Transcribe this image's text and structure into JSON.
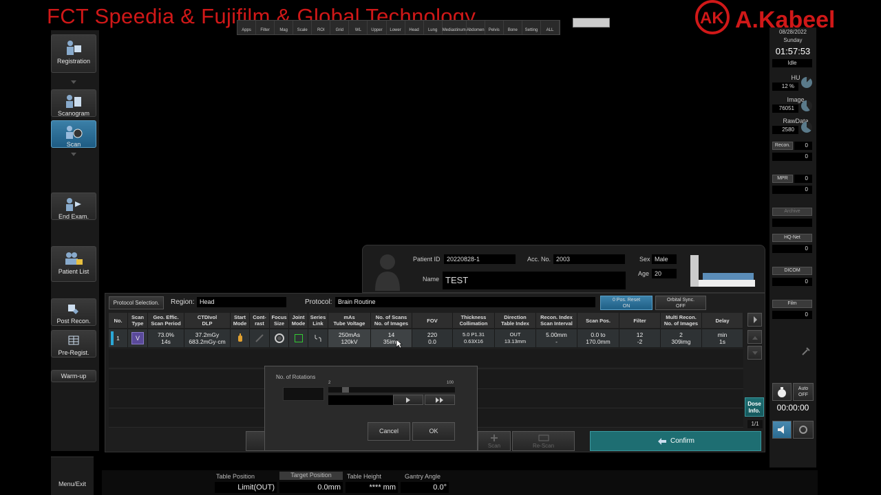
{
  "watermark": {
    "left": "FCT Speedia & Fujifilm & Global Technology",
    "right": "A.Kabeel"
  },
  "toolbar": {
    "items": [
      "Apps",
      "Filter",
      "Mag",
      "Scale",
      "ROI",
      "Grid",
      "WL",
      "Upper",
      "Lower",
      "Head",
      "Lung",
      "Mediastinum",
      "Abdomen",
      "Pelvis",
      "Bone",
      "Setting",
      "ALL"
    ]
  },
  "leftnav": {
    "registration": "Registration",
    "scanogram": "Scanogram",
    "scan": "Scan",
    "end_exam": "End Exam.",
    "patient_list": "Patient List",
    "post_recon": "Post Recon.",
    "pre_regist": "Pre-Regist.",
    "warm_up": "Warm-up",
    "menu_exit": "Menu/Exit"
  },
  "status_panel": {
    "date": "08/28/2022",
    "weekday": "Sunday",
    "time": "01:57:53",
    "state": "Idle",
    "hu_label": "HU",
    "hu_value": "12 %",
    "image_label": "Image",
    "image_value": "76051",
    "rawdata_label": "RawData",
    "rawdata_value": "2580",
    "recon_label": "Recon.",
    "recon_value": "0",
    "recon_value2": "0",
    "mpr_label": "MPR",
    "mpr_value": "0",
    "mpr_value2": "0",
    "archive_label": "Archive",
    "hqnet_label": "HQ-Net",
    "hqnet_value": "0",
    "dicom_label": "DICOM",
    "dicom_value": "0",
    "film_label": "Film",
    "film_value": "0",
    "auto_label": "Auto",
    "auto_value": "OFF",
    "timer": "00:00:00",
    "dose_info": "Dose Info.",
    "page": "1/1"
  },
  "patient": {
    "id_label": "Patient ID",
    "id": "20220828-1",
    "acc_label": "Acc. No.",
    "acc": "2003",
    "sex_label": "Sex",
    "sex": "Male",
    "name_label": "Name",
    "name": "TEST",
    "age_label": "Age",
    "age": "20"
  },
  "protocol": {
    "selection_btn": "Protocol Selection.",
    "region_label": "Region:",
    "region": "Head",
    "protocol_label": "Protocol:",
    "protocol": "Brain Routine",
    "pos_reset": "0 Pos. Reset",
    "pos_reset_state": "ON",
    "orbital_sync": "Orbital Sync.",
    "orbital_state": "OFF"
  },
  "table": {
    "headers": [
      "No.",
      "Scan\nType",
      "Geo. Effic.\nScan Period",
      "CTDIvol\nDLP",
      "Start\nMode",
      "Cont-\nrast",
      "Focus\nSize",
      "Joint\nMode",
      "Series\nLink",
      "mAs\nTube Voltage",
      "No. of Scans\nNo. of Images",
      "FOV",
      "Thickness\nCollimation",
      "Direction\nTable Index",
      "Recon. Index\nScan Interval",
      "Scan Pos.",
      "Filter",
      "Multi Recon.\nNo. of Images",
      "Delay"
    ],
    "row": {
      "no": "1",
      "scan_type": "V",
      "geo": "73.0%\n14s",
      "ctdi": "37.2mGy\n683.2mGy·cm",
      "mas": "250mAs\n120kV",
      "scans": "14\n35img",
      "fov": "220\n0.0",
      "thickness": "5.0 P1.31\n0.63X16",
      "direction": "OUT\n13.13mm",
      "recon": "5.00mm\n-",
      "scanpos": "0.0 to\n170.0mm",
      "filter": "12\n-2",
      "multi": "2\n309img",
      "delay": "min\n1s"
    }
  },
  "dialog": {
    "title": "No. of Rotations",
    "min": "2",
    "max": "100",
    "cancel": "Cancel",
    "ok": "OK"
  },
  "actions": {
    "scan": "Scan",
    "rescan": "Re-Scan",
    "confirm": "Confirm"
  },
  "statusbar": {
    "table_position_label": "Table Position",
    "table_position": "Limit(OUT)",
    "target_position_label": "Target Position",
    "target_position": "0.0mm",
    "table_height_label": "Table Height",
    "table_height": "**** mm",
    "gantry_angle_label": "Gantry Angle",
    "gantry_angle": "0.0°"
  }
}
